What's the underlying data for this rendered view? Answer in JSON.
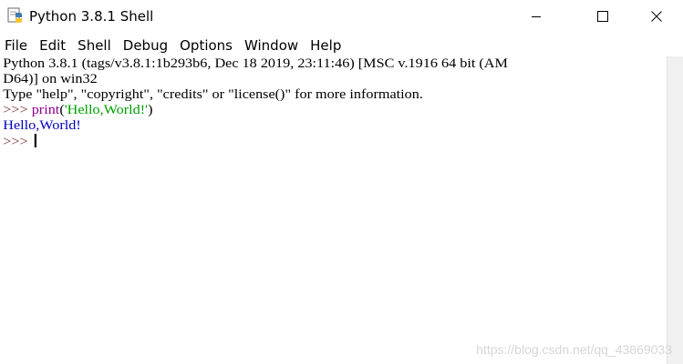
{
  "window": {
    "title": "Python 3.8.1 Shell",
    "icon": "python-idle-icon"
  },
  "window_controls": {
    "minimize_icon": "minimize-icon",
    "maximize_icon": "maximize-icon",
    "close_icon": "close-icon"
  },
  "menu": {
    "items": [
      "File",
      "Edit",
      "Shell",
      "Debug",
      "Options",
      "Window",
      "Help"
    ]
  },
  "shell": {
    "banner_line1": "Python 3.8.1 (tags/v3.8.1:1b293b6, Dec 18 2019, 23:11:46) [MSC v.1916 64 bit (AM",
    "banner_line2": "D64)] on win32",
    "banner_line3": "Type \"help\", \"copyright\", \"credits\" or \"license()\" for more information.",
    "prompt": ">>> ",
    "command_func": "print",
    "command_open": "(",
    "command_string": "'Hello,World!'",
    "command_close": ")",
    "output": "Hello,World!",
    "current_prompt": ">>> "
  },
  "watermark": "https://blog.csdn.net/qq_43869033",
  "colors": {
    "prompt": "#7a2a2a",
    "builtin": "#900090",
    "string": "#00a000",
    "output": "#0000c0"
  }
}
